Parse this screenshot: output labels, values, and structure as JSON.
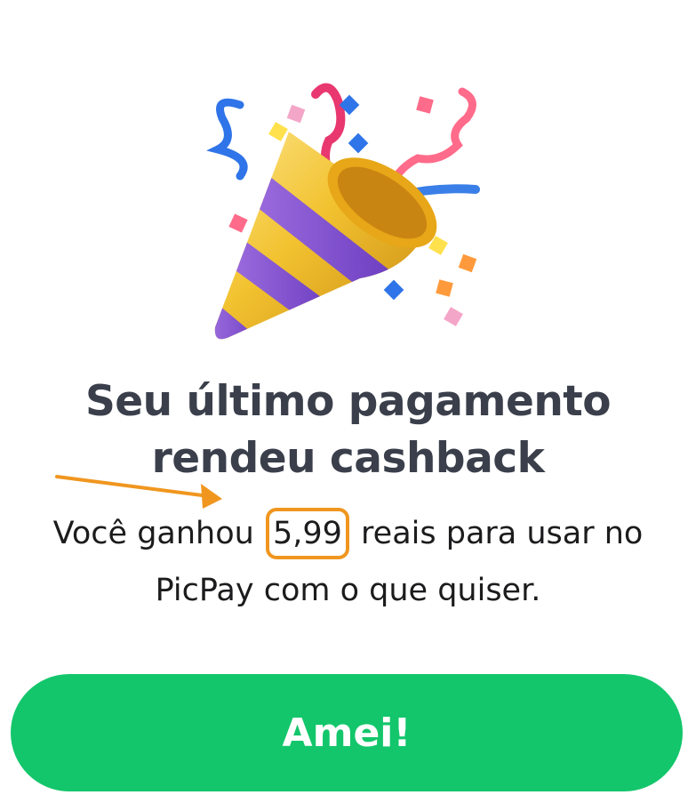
{
  "illustration": {
    "icon": "party-popper-icon"
  },
  "heading": {
    "line1": "Seu último pagamento",
    "line2": "rendeu cashback"
  },
  "message": {
    "prefix": "Você ganhou",
    "amount": "5,99",
    "suffix": "reais para usar no",
    "line2": "PicPay com o que quiser."
  },
  "annotation": {
    "arrow_color": "#f0961f",
    "highlight_color": "#f0961f"
  },
  "button": {
    "label": "Amei!",
    "color": "#13c66b"
  }
}
